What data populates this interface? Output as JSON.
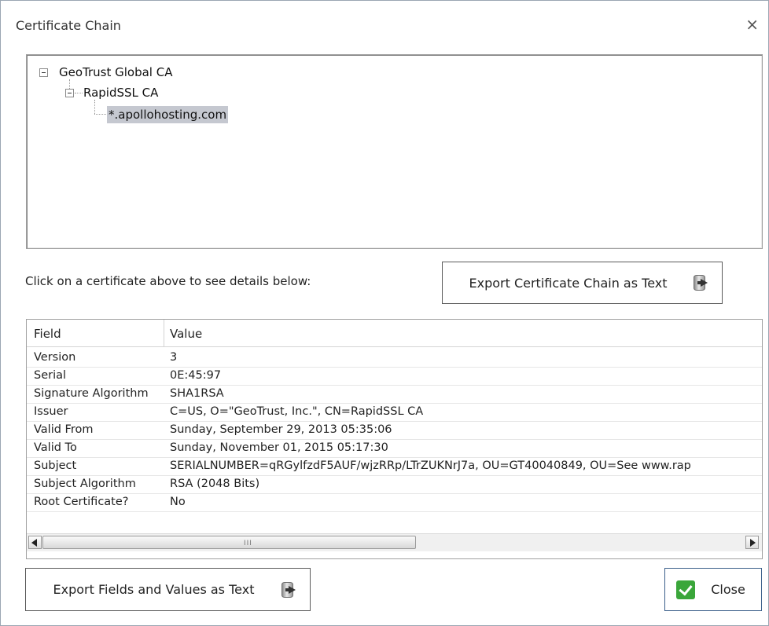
{
  "window": {
    "title": "Certificate Chain",
    "close_glyph": "×"
  },
  "tree": {
    "root": "GeoTrust Global CA",
    "intermediate": "RapidSSL CA",
    "leaf": "*.apollohosting.com"
  },
  "hint": "Click on a certificate above to see details below:",
  "buttons": {
    "export_chain": "Export Certificate Chain as Text",
    "export_fields": "Export Fields and Values as Text",
    "close": "Close"
  },
  "grid": {
    "columns": [
      "Field",
      "Value"
    ],
    "rows": [
      {
        "field": "Version",
        "value": "3"
      },
      {
        "field": "Serial",
        "value": "0E:45:97"
      },
      {
        "field": "Signature Algorithm",
        "value": "SHA1RSA"
      },
      {
        "field": "Issuer",
        "value": "C=US, O=\"GeoTrust, Inc.\", CN=RapidSSL CA"
      },
      {
        "field": "Valid From",
        "value": "Sunday, September 29, 2013 05:35:06"
      },
      {
        "field": "Valid To",
        "value": "Sunday, November 01, 2015 05:17:30"
      },
      {
        "field": "Subject",
        "value": "SERIALNUMBER=qRGylfzdF5AUF/wjzRRp/LTrZUKNrJ7a, OU=GT40040849, OU=See www.rap"
      },
      {
        "field": "Subject Algorithm",
        "value": "RSA (2048 Bits)"
      },
      {
        "field": "Root Certificate?",
        "value": "No"
      }
    ],
    "scroll_grip": "III"
  },
  "icons": {
    "export": "export-database-icon",
    "check": "check-icon",
    "expand": "collapse-minus-icon"
  },
  "colors": {
    "selection": "#c5c8d0",
    "accent": "#3aa63a"
  }
}
